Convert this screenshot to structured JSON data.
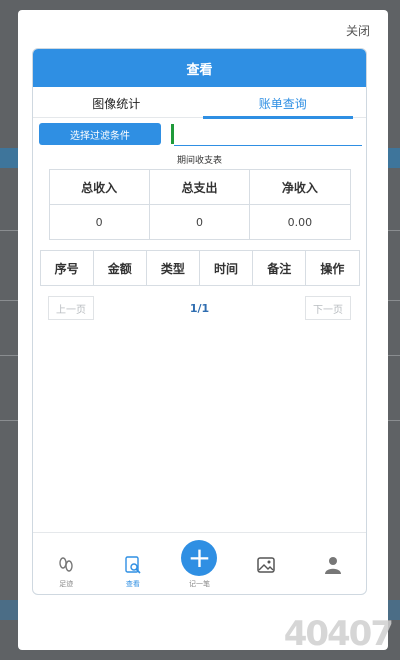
{
  "close_label": "关闭",
  "dialog": {
    "title": "查看",
    "tabs": [
      {
        "label": "图像统计",
        "active": false
      },
      {
        "label": "账单查询",
        "active": true
      }
    ],
    "filter_button": "选择过滤条件",
    "period_title": "期间收支表",
    "summary": {
      "headers": [
        "总收入",
        "总支出",
        "净收入"
      ],
      "values": [
        "0",
        "0",
        "0.00"
      ]
    },
    "records": {
      "headers": [
        "序号",
        "金额",
        "类型",
        "时间",
        "备注",
        "操作"
      ]
    },
    "pager": {
      "prev": "上一页",
      "page_info": "1/1",
      "next": "下一页"
    }
  },
  "bottom_nav": [
    {
      "label": "足迹",
      "icon": "footprints-icon"
    },
    {
      "label": "查看",
      "icon": "search-document-icon",
      "active": true
    },
    {
      "label": "记一笔",
      "icon": "plus-circle-icon"
    },
    {
      "label": "",
      "icon": "image-icon"
    },
    {
      "label": "",
      "icon": "user-icon"
    }
  ],
  "watermark": "40407"
}
